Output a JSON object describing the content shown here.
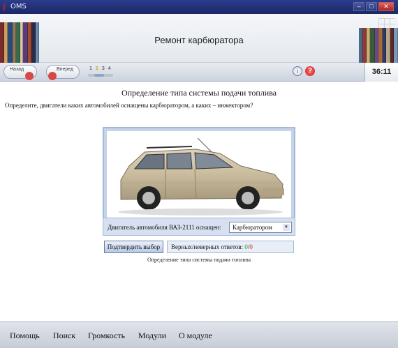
{
  "window": {
    "title": "OMS"
  },
  "header": {
    "title": "Ремонт карбюратора"
  },
  "toolbar": {
    "back_label": "Назад",
    "forward_label": "Вперед",
    "steps": [
      "1",
      "2",
      "3",
      "4"
    ],
    "active_step": "2",
    "timer": "36:11"
  },
  "content": {
    "title": "Определение типа системы подачи топлива",
    "question": "Определите, двигатели каких автомобилей оснащены карбюратором, а каких – инжектором?",
    "engine_label": "Двигатель автомобиля ВАЗ-2111 оснащен:",
    "engine_value": "Карбюратором",
    "confirm_label": "Подтвердить выбор",
    "answers_label": "Верных/неверных ответов:",
    "answers_right": "0",
    "answers_sep": "/",
    "answers_wrong": "0",
    "caption": "Определение типа системы подачи топлива"
  },
  "menu": {
    "items": [
      "Помощь",
      "Поиск",
      "Громкость",
      "Модули",
      "О модуле"
    ]
  },
  "colors": {
    "accent": "#2c3c8c",
    "panel_border": "#a4b8d8",
    "correct": "#2a9a2a",
    "wrong": "#d42020"
  }
}
